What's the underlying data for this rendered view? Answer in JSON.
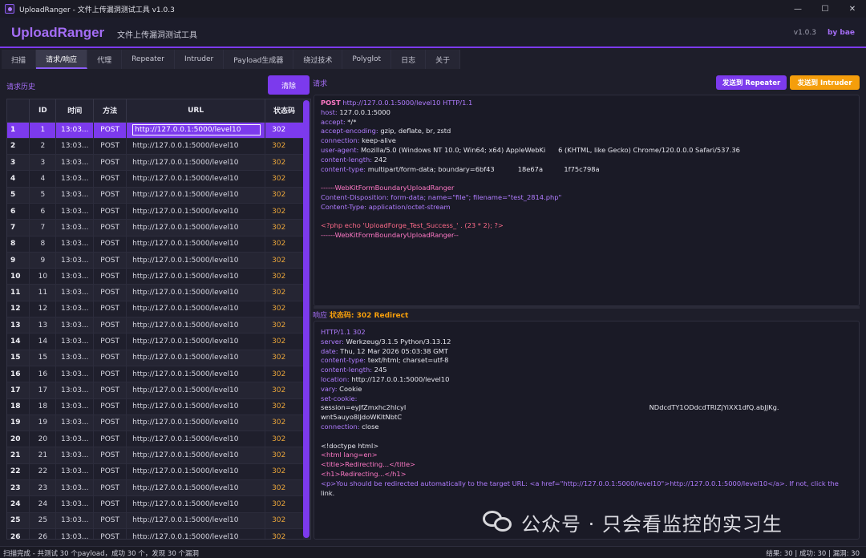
{
  "window": {
    "title": "UploadRanger - 文件上传漏洞测试工具 v1.0.3",
    "minimize": "—",
    "maximize": "☐",
    "close": "✕"
  },
  "header": {
    "brand": "UploadRanger",
    "subtitle": "文件上传漏洞测试工具",
    "version": "v1.0.3",
    "author": "by bae"
  },
  "tabs": [
    "扫描",
    "请求/响应",
    "代理",
    "Repeater",
    "Intruder",
    "Payload生成器",
    "绕过技术",
    "Polyglot",
    "日志",
    "关于"
  ],
  "active_tab": "请求/响应",
  "history": {
    "label": "请求历史",
    "clear_button": "清除",
    "columns": [
      "",
      "ID",
      "时间",
      "方法",
      "URL",
      "状态码"
    ],
    "rows": [
      {
        "n": "1",
        "id": "1",
        "time": "13:03...",
        "method": "POST",
        "url": "http://127.0.0.1:5000/level10",
        "status": "302"
      },
      {
        "n": "2",
        "id": "2",
        "time": "13:03...",
        "method": "POST",
        "url": "http://127.0.0.1:5000/level10",
        "status": "302"
      },
      {
        "n": "3",
        "id": "3",
        "time": "13:03...",
        "method": "POST",
        "url": "http://127.0.0.1:5000/level10",
        "status": "302"
      },
      {
        "n": "4",
        "id": "4",
        "time": "13:03...",
        "method": "POST",
        "url": "http://127.0.0.1:5000/level10",
        "status": "302"
      },
      {
        "n": "5",
        "id": "5",
        "time": "13:03...",
        "method": "POST",
        "url": "http://127.0.0.1:5000/level10",
        "status": "302"
      },
      {
        "n": "6",
        "id": "6",
        "time": "13:03...",
        "method": "POST",
        "url": "http://127.0.0.1:5000/level10",
        "status": "302"
      },
      {
        "n": "7",
        "id": "7",
        "time": "13:03...",
        "method": "POST",
        "url": "http://127.0.0.1:5000/level10",
        "status": "302"
      },
      {
        "n": "8",
        "id": "8",
        "time": "13:03...",
        "method": "POST",
        "url": "http://127.0.0.1:5000/level10",
        "status": "302"
      },
      {
        "n": "9",
        "id": "9",
        "time": "13:03...",
        "method": "POST",
        "url": "http://127.0.0.1:5000/level10",
        "status": "302"
      },
      {
        "n": "10",
        "id": "10",
        "time": "13:03...",
        "method": "POST",
        "url": "http://127.0.0.1:5000/level10",
        "status": "302"
      },
      {
        "n": "11",
        "id": "11",
        "time": "13:03...",
        "method": "POST",
        "url": "http://127.0.0.1:5000/level10",
        "status": "302"
      },
      {
        "n": "12",
        "id": "12",
        "time": "13:03...",
        "method": "POST",
        "url": "http://127.0.0.1:5000/level10",
        "status": "302"
      },
      {
        "n": "13",
        "id": "13",
        "time": "13:03...",
        "method": "POST",
        "url": "http://127.0.0.1:5000/level10",
        "status": "302"
      },
      {
        "n": "14",
        "id": "14",
        "time": "13:03...",
        "method": "POST",
        "url": "http://127.0.0.1:5000/level10",
        "status": "302"
      },
      {
        "n": "15",
        "id": "15",
        "time": "13:03...",
        "method": "POST",
        "url": "http://127.0.0.1:5000/level10",
        "status": "302"
      },
      {
        "n": "16",
        "id": "16",
        "time": "13:03...",
        "method": "POST",
        "url": "http://127.0.0.1:5000/level10",
        "status": "302"
      },
      {
        "n": "17",
        "id": "17",
        "time": "13:03...",
        "method": "POST",
        "url": "http://127.0.0.1:5000/level10",
        "status": "302"
      },
      {
        "n": "18",
        "id": "18",
        "time": "13:03...",
        "method": "POST",
        "url": "http://127.0.0.1:5000/level10",
        "status": "302"
      },
      {
        "n": "19",
        "id": "19",
        "time": "13:03...",
        "method": "POST",
        "url": "http://127.0.0.1:5000/level10",
        "status": "302"
      },
      {
        "n": "20",
        "id": "20",
        "time": "13:03...",
        "method": "POST",
        "url": "http://127.0.0.1:5000/level10",
        "status": "302"
      },
      {
        "n": "21",
        "id": "21",
        "time": "13:03...",
        "method": "POST",
        "url": "http://127.0.0.1:5000/level10",
        "status": "302"
      },
      {
        "n": "22",
        "id": "22",
        "time": "13:03...",
        "method": "POST",
        "url": "http://127.0.0.1:5000/level10",
        "status": "302"
      },
      {
        "n": "23",
        "id": "23",
        "time": "13:03...",
        "method": "POST",
        "url": "http://127.0.0.1:5000/level10",
        "status": "302"
      },
      {
        "n": "24",
        "id": "24",
        "time": "13:03...",
        "method": "POST",
        "url": "http://127.0.0.1:5000/level10",
        "status": "302"
      },
      {
        "n": "25",
        "id": "25",
        "time": "13:03...",
        "method": "POST",
        "url": "http://127.0.0.1:5000/level10",
        "status": "302"
      },
      {
        "n": "26",
        "id": "26",
        "time": "13:03...",
        "method": "POST",
        "url": "http://127.0.0.1:5000/level10",
        "status": "302"
      }
    ],
    "selected_row": 0
  },
  "request": {
    "label": "请求",
    "send_repeater": "发送到 Repeater",
    "send_intruder": "发送到 Intruder",
    "request_line": {
      "method": "POST",
      "url": "http://127.0.0.1:5000/level10",
      "proto": "HTTP/1.1"
    },
    "headers": [
      {
        "k": "host:",
        "v": " 127.0.0.1:5000"
      },
      {
        "k": "accept:",
        "v": " */*"
      },
      {
        "k": "accept-encoding:",
        "v": " gzip, deflate, br, zstd"
      },
      {
        "k": "connection:",
        "v": " keep-alive"
      },
      {
        "k": "user-agent:",
        "v": " Mozilla/5.0 (Windows NT 10.0; Win64; x64) AppleWebKi      6 (KHTML, like Gecko) Chrome/120.0.0.0 Safari/537.36"
      },
      {
        "k": "content-length:",
        "v": " 242"
      },
      {
        "k": "content-type:",
        "v": " multipart/form-data; boundary=6bf43           18e67a          1f75c798a"
      }
    ],
    "body": [
      {
        "cls": "pink",
        "t": "------WebKitFormBoundaryUploadRanger"
      },
      {
        "cls": "k",
        "t": "Content-Disposition: form-data; name=\"file\"; filename=\"test_2814.php\""
      },
      {
        "cls": "k",
        "t": "Content-Type: application/octet-stream"
      },
      {
        "cls": "",
        "t": ""
      },
      {
        "cls": "php",
        "t": "<?php echo 'UploadForge_Test_Success_' . (23 * 2); ?>"
      },
      {
        "cls": "pink",
        "t": "------WebKitFormBoundaryUploadRanger--"
      }
    ]
  },
  "response": {
    "label": "响应",
    "status_label": "状态码: 302 Redirect",
    "status_line": "HTTP/1.1 302",
    "headers": [
      {
        "k": "server:",
        "v": " Werkzeug/3.1.5 Python/3.13.12"
      },
      {
        "k": "date:",
        "v": " Thu, 12 Mar 2026 05:03:38 GMT"
      },
      {
        "k": "content-type:",
        "v": " text/html; charset=utf-8"
      },
      {
        "k": "content-length:",
        "v": " 245"
      },
      {
        "k": "location:",
        "v": " http://127.0.0.1:5000/level10"
      },
      {
        "k": "vary:",
        "v": " Cookie"
      },
      {
        "k": "set-cookie:",
        "v": ""
      },
      {
        "k": "",
        "v": "session=eyJfZmxhc2hlcyI                                                                                                                   NDdcdTY1ODdcdTRlZjYiXX1dfQ.abJJKg."
      },
      {
        "k": "",
        "v": "wnt5auyo8lJdoWKltNbtC"
      },
      {
        "k": "connection:",
        "v": " close"
      }
    ],
    "body": [
      {
        "cls": "v",
        "t": ""
      },
      {
        "cls": "v",
        "t": "<!doctype html>"
      },
      {
        "cls": "pink",
        "t": "<html lang=en>"
      },
      {
        "cls": "pink",
        "t": "<title>Redirecting...</title>"
      },
      {
        "cls": "pink",
        "t": "<h1>Redirecting...</h1>"
      },
      {
        "cls": "k",
        "t": "<p>You should be redirected automatically to the target URL: <a href=\"http://127.0.0.1:5000/level10\">http://127.0.0.1:5000/level10</a>. If not, click the"
      },
      {
        "cls": "v",
        "t": "link."
      }
    ]
  },
  "watermark": "公众号 · 只会看监控的实习生",
  "status": {
    "left": "扫描完成 - 共测试 30 个payload，成功 30 个，发现 30 个漏洞",
    "right": "结果: 30 | 成功: 30 | 漏洞: 30"
  }
}
